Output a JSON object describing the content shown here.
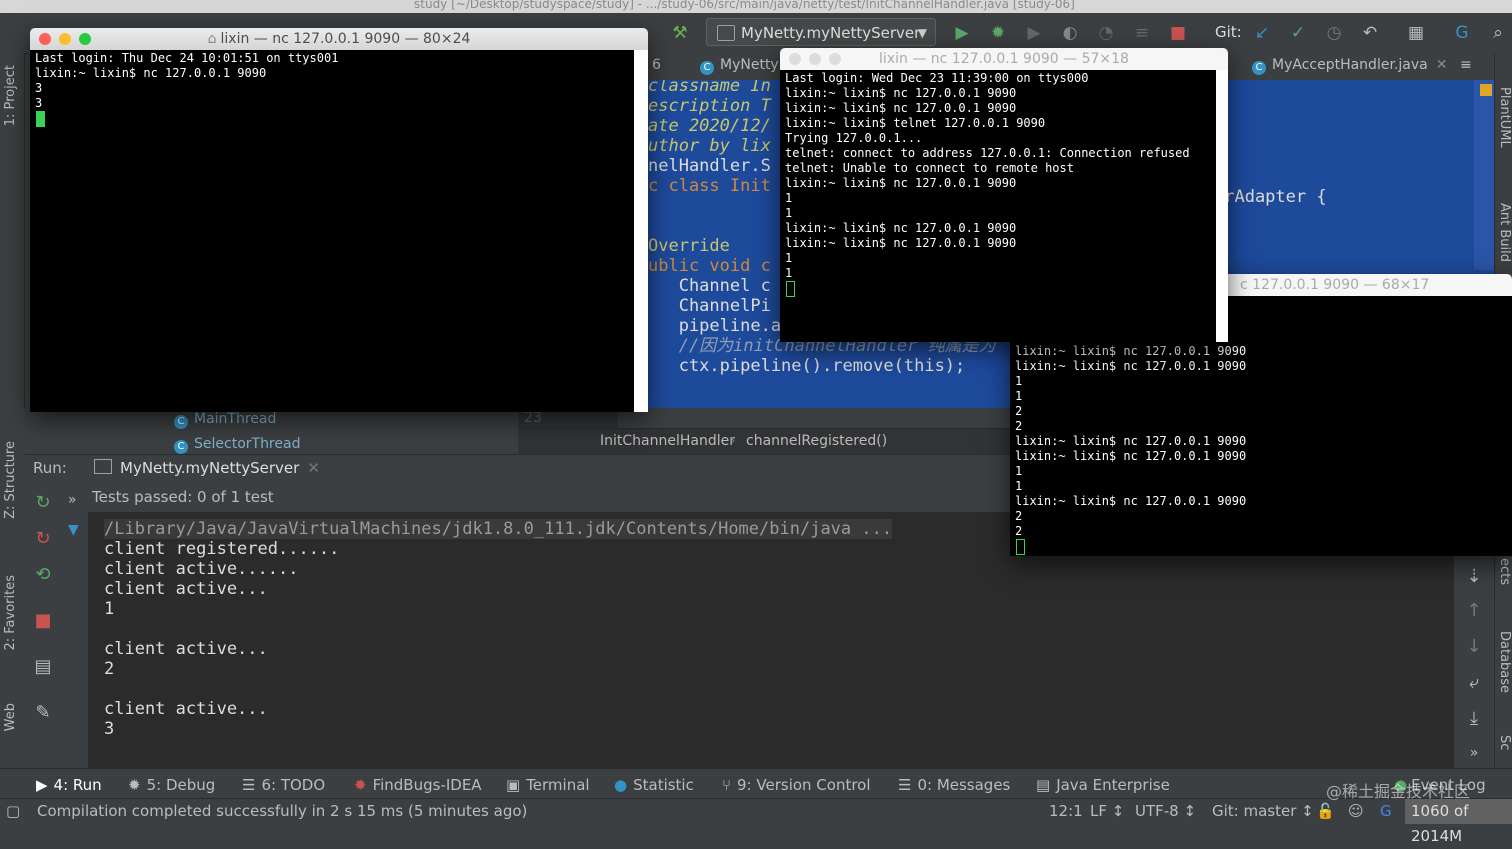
{
  "ide": {
    "window_title": "study [~/Desktop/studyspace/study] - .../study-06/src/main/java/netty/test/InitChannelHandler.java [study-06]",
    "run_config": "MyNetty.myNettyServer",
    "git_label": "Git:"
  },
  "left_stripe": [
    "1: Project",
    "Z: Structure",
    "2: Favorites",
    "Web"
  ],
  "right_stripe": [
    "PlantUML",
    "Ant Build",
    "ects",
    "Database",
    "Sc"
  ],
  "editor": {
    "tabs": [
      "6",
      "MyNetty",
      "MyAcceptHandler.java"
    ],
    "tab_overflow": "≡",
    "code_lines": [
      {
        "text": "classname In",
        "color": "#c8c86a",
        "italic": true
      },
      {
        "text": "escription T",
        "color": "#c8c86a",
        "italic": true
      },
      {
        "text": "ate 2020/12/",
        "color": "#c8c86a",
        "italic": true
      },
      {
        "text": "uthor by lix",
        "color": "#c8c86a",
        "italic": true
      },
      {
        "text": "nelHandler.S",
        "color": "#dddddd",
        "italic": false
      },
      {
        "text": "c class Init",
        "color": "#cc8a3d",
        "italic": false
      },
      {
        "text": "",
        "color": "#dddddd",
        "italic": false
      },
      {
        "text": "",
        "color": "#dddddd",
        "italic": false
      },
      {
        "text": "Override",
        "color": "#c8c86a",
        "italic": false
      },
      {
        "text": "ublic void c",
        "color": "#cc8a3d",
        "italic": false
      },
      {
        "text": "   Channel c",
        "color": "#dddddd",
        "italic": false
      },
      {
        "text": "   ChannelPi",
        "color": "#dddddd",
        "italic": false
      },
      {
        "text": "   pipeline.addLast(new MyInHandle",
        "color": "#dddddd",
        "italic": false
      },
      {
        "text": "   //因为initChannelHandler 纯属是为",
        "color": "#8f9fb6",
        "italic": true
      },
      {
        "text": "   ctx.pipeline().remove(this);",
        "color": "#dddddd",
        "italic": false
      }
    ],
    "right_code": "erAdapter {",
    "gutter_line": "23"
  },
  "breadcrumb": [
    "InitChannelHandler",
    "channelRegistered()"
  ],
  "project_items": [
    "MainThread",
    "SelectorThread"
  ],
  "run": {
    "label": "Run:",
    "tab": "MyNetty.myNettyServer",
    "tests_passed": "Tests passed: 0 of 1 test",
    "console": [
      "/Library/Java/JavaVirtualMachines/jdk1.8.0_111.jdk/Contents/Home/bin/java ...",
      "client registered......",
      "client active......",
      "client active...",
      "1",
      "",
      "client active...",
      "2",
      "",
      "client active...",
      "3"
    ]
  },
  "tool_tabs": [
    "4: Run",
    "5: Debug",
    "6: TODO",
    "FindBugs-IDEA",
    "Terminal",
    "Statistic",
    "9: Version Control",
    "0: Messages",
    "Java Enterprise",
    "Event Log"
  ],
  "status": {
    "message": "Compilation completed successfully in 2 s 15 ms (5 minutes ago)",
    "position": "12:1",
    "line_sep": "LF ↕",
    "encoding": "UTF-8 ↕",
    "branch": "Git: master ↕",
    "memory": "1060 of 2014M",
    "watermark": "@稀土掘金技术社区"
  },
  "terminals": [
    {
      "title": "lixin — nc 127.0.0.1 9090 — 80×24",
      "lines": [
        "Last login: Thu Dec 24 10:01:51 on ttys001",
        "lixin:~ lixin$ nc 127.0.0.1 9090",
        "3",
        "3"
      ],
      "cursor_color": "#39d353"
    },
    {
      "title": "lixin — nc 127.0.0.1 9090 — 57×18",
      "lines": [
        "Last login: Wed Dec 23 11:39:00 on ttys000",
        "lixin:~ lixin$ nc 127.0.0.1 9090",
        "lixin:~ lixin$ nc 127.0.0.1 9090",
        "lixin:~ lixin$ telnet 127.0.0.1 9090",
        "Trying 127.0.0.1...",
        "telnet: connect to address 127.0.0.1: Connection refused",
        "telnet: Unable to connect to remote host",
        "lixin:~ lixin$ nc 127.0.0.1 9090",
        "1",
        "1",
        "lixin:~ lixin$ nc 127.0.0.1 9090",
        "lixin:~ lixin$ nc 127.0.0.1 9090",
        "1",
        "1"
      ],
      "cursor_color": "#39d353"
    },
    {
      "title": "c 127.0.0.1 9090 — 68×17",
      "lines": [
        "lixin:~ lixin$ nc 127.0.0.1 9090",
        "lixin:~ lixin$ nc 127.0.0.1 9090",
        "1",
        "1",
        "2",
        "2",
        "lixin:~ lixin$ nc 127.0.0.1 9090",
        "lixin:~ lixin$ nc 127.0.0.1 9090",
        "1",
        "1",
        "lixin:~ lixin$ nc 127.0.0.1 9090",
        "2",
        "2"
      ],
      "cursor_color": "#39d353"
    }
  ],
  "colors": {
    "terminal_text": "#ffffff",
    "editor_bg": "#1e4a9c",
    "accent_green": "#39d353"
  }
}
